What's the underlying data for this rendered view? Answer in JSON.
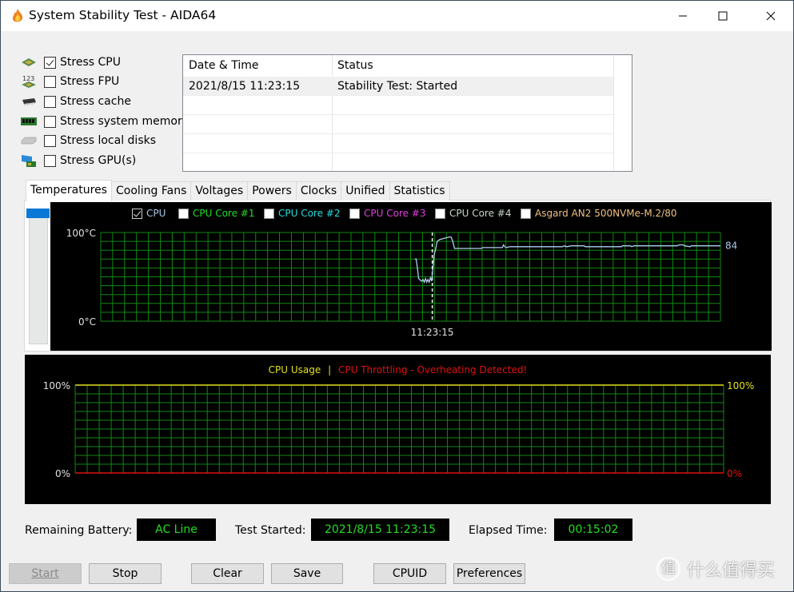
{
  "window": {
    "title": "System Stability Test - AIDA64",
    "controls": {
      "minimize": "minimize-icon",
      "maximize": "maximize-icon",
      "close": "close-icon"
    }
  },
  "stress_options": [
    {
      "label": "Stress CPU",
      "checked": true,
      "icon": "cpu-chip-icon"
    },
    {
      "label": "Stress FPU",
      "checked": false,
      "icon": "fpu-chip-icon"
    },
    {
      "label": "Stress cache",
      "checked": false,
      "icon": "cache-chip-icon"
    },
    {
      "label": "Stress system memory",
      "checked": false,
      "icon": "memory-module-icon"
    },
    {
      "label": "Stress local disks",
      "checked": false,
      "icon": "disk-drive-icon"
    },
    {
      "label": "Stress GPU(s)",
      "checked": false,
      "icon": "gpu-card-icon"
    }
  ],
  "log": {
    "columns": [
      "Date & Time",
      "Status"
    ],
    "rows": [
      {
        "datetime": "2021/8/15 11:23:15",
        "status": "Stability Test: Started"
      },
      {
        "datetime": "",
        "status": ""
      },
      {
        "datetime": "",
        "status": ""
      },
      {
        "datetime": "",
        "status": ""
      },
      {
        "datetime": "",
        "status": ""
      }
    ]
  },
  "tabs": [
    {
      "label": "Temperatures",
      "active": true
    },
    {
      "label": "Cooling Fans",
      "active": false
    },
    {
      "label": "Voltages",
      "active": false
    },
    {
      "label": "Powers",
      "active": false
    },
    {
      "label": "Clocks",
      "active": false
    },
    {
      "label": "Unified",
      "active": false
    },
    {
      "label": "Statistics",
      "active": false
    }
  ],
  "chart_data": [
    {
      "type": "line",
      "title": "Temperatures",
      "legend": [
        {
          "name": "CPU",
          "checked": true,
          "color": "#a8c8e8"
        },
        {
          "name": "CPU Core #1",
          "checked": false,
          "color": "#22dd22"
        },
        {
          "name": "CPU Core #2",
          "checked": false,
          "color": "#22dddd"
        },
        {
          "name": "CPU Core #3",
          "checked": false,
          "color": "#e040e0"
        },
        {
          "name": "CPU Core #4",
          "checked": false,
          "color": "#c8d8c8"
        },
        {
          "name": "Asgard AN2 500NVMe-M.2/80",
          "checked": false,
          "color": "#f0c080"
        }
      ],
      "ylim": [
        0,
        100
      ],
      "y_tick_labels": [
        "100°C",
        "0°C"
      ],
      "x_marker_label": "11:23:15",
      "x_marker_position": 0.535,
      "current_value_label": "84",
      "grid": true,
      "grid_color": "#118811",
      "series": [
        {
          "name": "CPU",
          "color": "#b0d0f0",
          "points": [
            [
              0.507,
              70
            ],
            [
              0.509,
              70
            ],
            [
              0.511,
              60
            ],
            [
              0.513,
              48
            ],
            [
              0.516,
              46
            ],
            [
              0.518,
              45
            ],
            [
              0.52,
              47
            ],
            [
              0.522,
              44
            ],
            [
              0.524,
              48
            ],
            [
              0.526,
              44
            ],
            [
              0.528,
              47
            ],
            [
              0.53,
              44
            ],
            [
              0.532,
              49
            ],
            [
              0.534,
              45
            ],
            [
              0.536,
              60
            ],
            [
              0.538,
              75
            ],
            [
              0.54,
              80
            ],
            [
              0.543,
              90
            ],
            [
              0.547,
              92
            ],
            [
              0.552,
              93
            ],
            [
              0.557,
              94
            ],
            [
              0.563,
              95
            ],
            [
              0.565,
              95
            ],
            [
              0.566,
              94
            ],
            [
              0.568,
              90
            ],
            [
              0.571,
              82
            ],
            [
              0.575,
              82
            ],
            [
              0.6,
              82
            ],
            [
              0.615,
              82
            ],
            [
              0.616,
              83
            ],
            [
              0.648,
              83
            ],
            [
              0.65,
              86
            ],
            [
              0.652,
              84
            ],
            [
              0.655,
              83
            ],
            [
              0.66,
              84
            ],
            [
              0.745,
              84
            ],
            [
              0.748,
              85
            ],
            [
              0.752,
              84
            ],
            [
              0.76,
              85
            ],
            [
              0.78,
              85
            ],
            [
              0.782,
              84
            ],
            [
              0.84,
              84
            ],
            [
              0.842,
              85
            ],
            [
              0.855,
              85
            ],
            [
              0.857,
              84
            ],
            [
              0.86,
              85
            ],
            [
              0.93,
              85
            ],
            [
              0.933,
              86
            ],
            [
              0.94,
              86
            ],
            [
              0.942,
              85
            ],
            [
              0.951,
              84
            ],
            [
              0.953,
              85
            ],
            [
              1.0,
              85
            ]
          ]
        }
      ]
    },
    {
      "type": "line",
      "title": "CPU Usage | CPU Throttling - Overheating Detected!",
      "legend": [
        {
          "name": "CPU Usage",
          "color": "#e0e020"
        },
        {
          "name": "CPU Throttling - Overheating Detected!",
          "color": "#e01010"
        }
      ],
      "ylim": [
        0,
        100
      ],
      "left_tick_labels": [
        "100%",
        "0%"
      ],
      "right_tick_labels": [
        {
          "text": "100%",
          "color": "#e0e020"
        },
        {
          "text": "0%",
          "color": "#e01010"
        }
      ],
      "grid": true,
      "grid_color": "#118811",
      "series": [
        {
          "name": "CPU Usage",
          "color": "#e0e020",
          "value": 100
        },
        {
          "name": "CPU Throttling",
          "color": "#e01010",
          "value": 0
        }
      ]
    }
  ],
  "status": {
    "battery_label": "Remaining Battery:",
    "battery_value": "AC Line",
    "started_label": "Test Started:",
    "started_value": "2021/8/15 11:23:15",
    "elapsed_label": "Elapsed Time:",
    "elapsed_value": "00:15:02"
  },
  "buttons": {
    "start": "Start",
    "stop": "Stop",
    "clear": "Clear",
    "save": "Save",
    "cpuid": "CPUID",
    "preferences": "Preferences"
  },
  "watermark": {
    "text": "什么值得买",
    "icon": "zhi-logo-icon",
    "icon_char": "值"
  }
}
